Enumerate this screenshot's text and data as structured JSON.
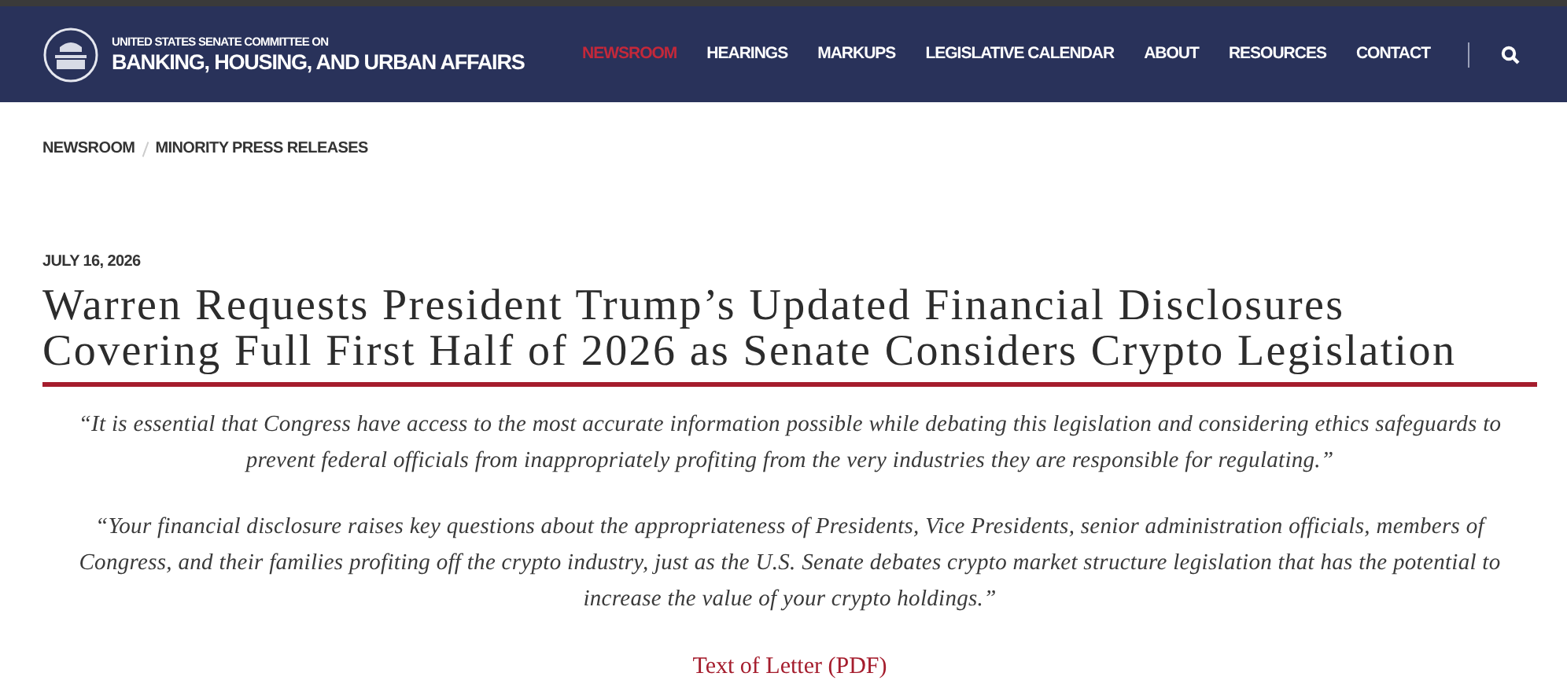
{
  "header": {
    "logo_line1": "UNITED STATES SENATE COMMITTEE ON",
    "logo_line2": "BANKING, HOUSING, AND URBAN AFFAIRS",
    "nav": [
      {
        "label": "NEWSROOM",
        "selected": true
      },
      {
        "label": "HEARINGS",
        "selected": false
      },
      {
        "label": "MARKUPS",
        "selected": false
      },
      {
        "label": "LEGISLATIVE CALENDAR",
        "selected": false
      },
      {
        "label": "ABOUT",
        "selected": false
      },
      {
        "label": "RESOURCES",
        "selected": false
      },
      {
        "label": "CONTACT",
        "selected": false
      }
    ]
  },
  "breadcrumb": [
    "NEWSROOM",
    "MINORITY PRESS RELEASES"
  ],
  "article": {
    "date": "JULY 16, 2026",
    "title": "Warren Requests President Trump’s Updated Financial Disclosures Covering Full First Half of 2026 as Senate Considers Crypto Legislation",
    "quotes": [
      "“It is essential that Congress have access to the most accurate information possible while debating this legislation and considering ethics safeguards to prevent federal officials from inappropriately profiting from the very industries they are responsible for regulating.”",
      "“Your financial disclosure raises key questions about the appropriateness of Presidents, Vice Presidents, senior administration officials, members of Congress, and their families profiting off the crypto industry, just as the U.S. Senate debates crypto market structure legislation that has the potential to increase the value of your crypto holdings.”"
    ],
    "link": "Text of Letter (PDF)"
  }
}
